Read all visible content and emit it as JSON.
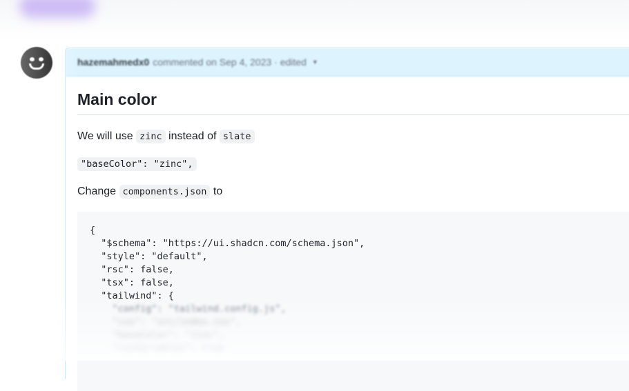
{
  "comment": {
    "author": "hazemahmedx0",
    "meta": "commented on Sep 4, 2023 · edited",
    "heading": "Main color",
    "para1": {
      "before": "We will use",
      "code1": "zinc",
      "middle": "instead of",
      "code2": "slate"
    },
    "config_line": "\"baseColor\": \"zinc\",",
    "para3": {
      "before": "Change",
      "code": "components.json",
      "after": "to"
    },
    "code_lines": [
      "{",
      "  \"$schema\": \"https://ui.shadcn.com/schema.json\",",
      "  \"style\": \"default\",",
      "  \"rsc\": false,",
      "  \"tsx\": false,",
      "  \"tailwind\": {",
      "    \"config\": \"tailwind.config.js\",",
      "    \"css\": \"src/index.css\",",
      "    \"baseColor\": \"zinc\",",
      "    \"cssVariables\": true"
    ]
  },
  "colors": {
    "header_bg": "#ddf4ff",
    "code_bg": "#f6f8fa"
  },
  "icons": {
    "caret": "caret-down-icon",
    "avatar": "avatar"
  }
}
